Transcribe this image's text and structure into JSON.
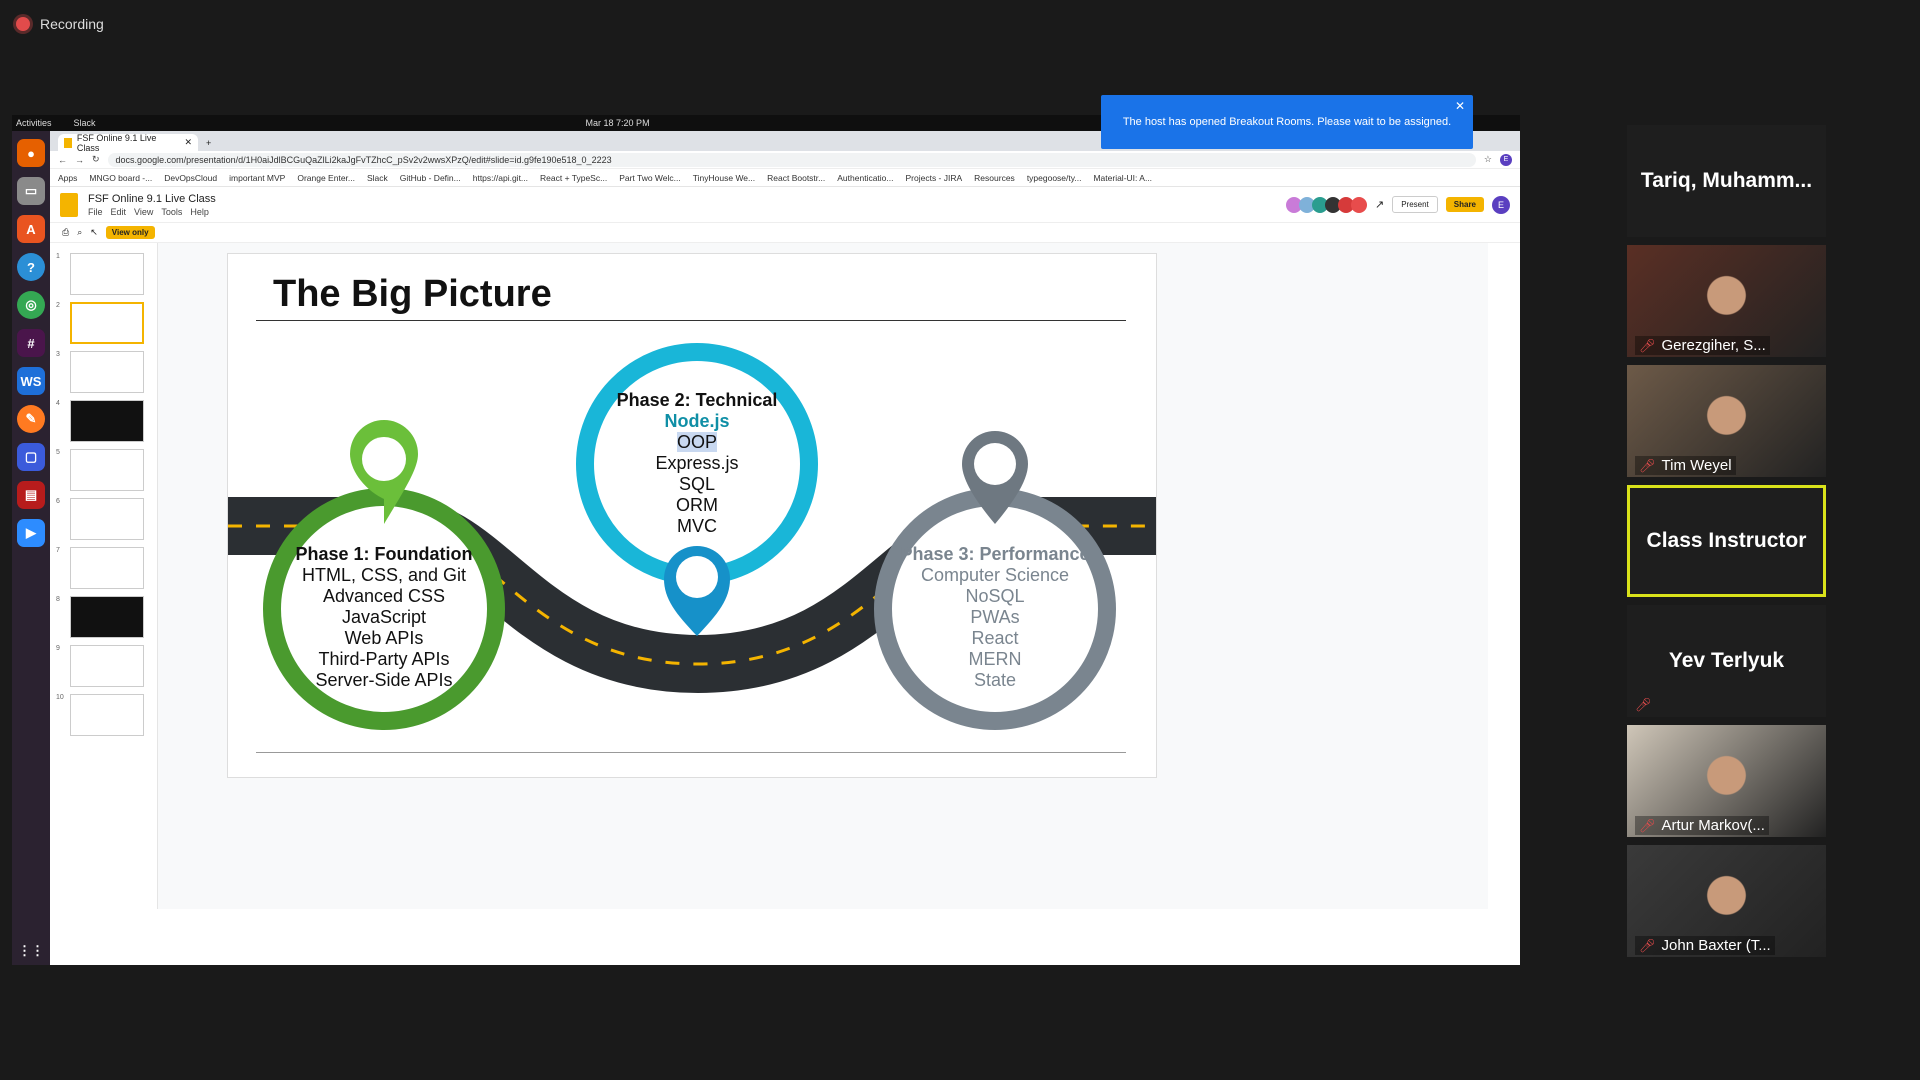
{
  "recording": {
    "label": "Recording"
  },
  "system": {
    "activities": "Activities",
    "app": "Slack",
    "clock": "Mar 18  7:20 PM"
  },
  "browser": {
    "tab_title": "FSF Online 9.1 Live Class",
    "url": "docs.google.com/presentation/d/1H0aiJdlBCGuQaZlLi2kaJgFvTZhcC_pSv2v2wwsXPzQ/edit#slide=id.g9fe190e518_0_2223",
    "bookmarks": [
      "Apps",
      "MNGO board -...",
      "DevOpsCloud",
      "important MVP",
      "Orange Enter...",
      "Slack",
      "GitHub - Defin...",
      "https://api.git...",
      "React + TypeSc...",
      "Part Two Welc...",
      "TinyHouse We...",
      "React Bootstr...",
      "Authenticatio...",
      "Projects - JIRA",
      "Resources",
      "typegoose/ty...",
      "Material-UI: A..."
    ]
  },
  "slides_app": {
    "title": "FSF Online 9.1 Live Class",
    "menu": [
      "File",
      "Edit",
      "View",
      "Tools",
      "Help"
    ],
    "view_only": "View only",
    "present": "Present",
    "share": "Share",
    "avatar": "E",
    "slide_numbers": [
      "1",
      "2",
      "3",
      "4",
      "5",
      "6",
      "7",
      "8",
      "9",
      "10"
    ]
  },
  "slide": {
    "title": "The Big Picture",
    "phase1": {
      "title": "Phase 1: Foundation",
      "items": [
        "HTML, CSS, and Git",
        "Advanced CSS",
        "JavaScript",
        "Web APIs",
        "Third-Party APIs",
        "Server-Side APIs"
      ]
    },
    "phase2": {
      "title": "Phase 2: Technical",
      "items": [
        "Node.js",
        "OOP",
        "Express.js",
        "SQL",
        "ORM",
        "MVC"
      ]
    },
    "phase3": {
      "title": "Phase 3: Performance",
      "items": [
        "Computer Science",
        "NoSQL",
        "PWAs",
        "React",
        "MERN",
        "State"
      ]
    },
    "colors": {
      "phase1": "#4a9a2e",
      "phase2": "#19b6d8",
      "phase3": "#7a858f",
      "road": "#2b2f33"
    }
  },
  "banner": {
    "text": "The host has opened Breakout Rooms. Please wait to be assigned."
  },
  "participants": [
    {
      "name": "Tariq,  Muhamm...",
      "video": false,
      "muted": false
    },
    {
      "name": "Gerezgiher, S...",
      "video": true,
      "muted": true
    },
    {
      "name": "Tim Weyel",
      "video": true,
      "muted": true
    },
    {
      "name": "Class Instructor",
      "video": false,
      "muted": false,
      "active": true
    },
    {
      "name": "Yev Terlyuk",
      "video": false,
      "muted": true
    },
    {
      "name": "Artur Markov(...",
      "video": true,
      "muted": true
    },
    {
      "name": "John Baxter (T...",
      "video": true,
      "muted": true
    }
  ]
}
